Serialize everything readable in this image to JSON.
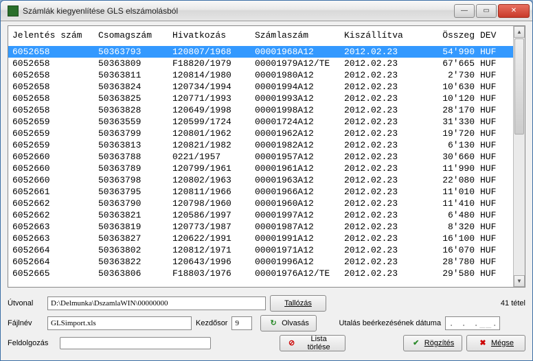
{
  "window": {
    "title": "Számlák kiegyenlítése GLS elszámolásból"
  },
  "columns": {
    "jelentes": "Jelentés szám",
    "csomag": "Csomagszám",
    "hivatkozas": "Hivatkozás",
    "szamla": "Számlaszám",
    "kiszallitva": "Kiszállítva",
    "osszeg": "Összeg",
    "dev": "DEV"
  },
  "rows": [
    {
      "jel": "6052658",
      "cs": "50363793",
      "hiv": "120807/1968",
      "sz": "00001968A12",
      "ki": "2012.02.23",
      "os": "54'990",
      "dev": "HUF",
      "sel": true
    },
    {
      "jel": "6052658",
      "cs": "50363809",
      "hiv": "F18820/1979",
      "sz": "00001979A12/TE",
      "ki": "2012.02.23",
      "os": "67'665",
      "dev": "HUF"
    },
    {
      "jel": "6052658",
      "cs": "50363811",
      "hiv": "120814/1980",
      "sz": "00001980A12",
      "ki": "2012.02.23",
      "os": "2'730",
      "dev": "HUF"
    },
    {
      "jel": "6052658",
      "cs": "50363824",
      "hiv": "120734/1994",
      "sz": "00001994A12",
      "ki": "2012.02.23",
      "os": "10'630",
      "dev": "HUF"
    },
    {
      "jel": "6052658",
      "cs": "50363825",
      "hiv": "120771/1993",
      "sz": "00001993A12",
      "ki": "2012.02.23",
      "os": "10'120",
      "dev": "HUF"
    },
    {
      "jel": "6052658",
      "cs": "50363828",
      "hiv": "120649/1998",
      "sz": "00001998A12",
      "ki": "2012.02.23",
      "os": "28'170",
      "dev": "HUF"
    },
    {
      "jel": "6052659",
      "cs": "50363559",
      "hiv": "120599/1724",
      "sz": "00001724A12",
      "ki": "2012.02.23",
      "os": "31'330",
      "dev": "HUF"
    },
    {
      "jel": "6052659",
      "cs": "50363799",
      "hiv": "120801/1962",
      "sz": "00001962A12",
      "ki": "2012.02.23",
      "os": "19'720",
      "dev": "HUF"
    },
    {
      "jel": "6052659",
      "cs": "50363813",
      "hiv": "120821/1982",
      "sz": "00001982A12",
      "ki": "2012.02.23",
      "os": "6'130",
      "dev": "HUF"
    },
    {
      "jel": "6052660",
      "cs": "50363788",
      "hiv": "0221/1957",
      "sz": "00001957A12",
      "ki": "2012.02.23",
      "os": "30'660",
      "dev": "HUF"
    },
    {
      "jel": "6052660",
      "cs": "50363789",
      "hiv": "120799/1961",
      "sz": "00001961A12",
      "ki": "2012.02.23",
      "os": "11'990",
      "dev": "HUF"
    },
    {
      "jel": "6052660",
      "cs": "50363798",
      "hiv": "120802/1963",
      "sz": "00001963A12",
      "ki": "2012.02.23",
      "os": "22'080",
      "dev": "HUF"
    },
    {
      "jel": "6052661",
      "cs": "50363795",
      "hiv": "120811/1966",
      "sz": "00001966A12",
      "ki": "2012.02.23",
      "os": "11'010",
      "dev": "HUF"
    },
    {
      "jel": "6052662",
      "cs": "50363790",
      "hiv": "120798/1960",
      "sz": "00001960A12",
      "ki": "2012.02.23",
      "os": "11'410",
      "dev": "HUF"
    },
    {
      "jel": "6052662",
      "cs": "50363821",
      "hiv": "120586/1997",
      "sz": "00001997A12",
      "ki": "2012.02.23",
      "os": "6'480",
      "dev": "HUF"
    },
    {
      "jel": "6052663",
      "cs": "50363819",
      "hiv": "120773/1987",
      "sz": "00001987A12",
      "ki": "2012.02.23",
      "os": "8'320",
      "dev": "HUF"
    },
    {
      "jel": "6052663",
      "cs": "50363827",
      "hiv": "120622/1991",
      "sz": "00001991A12",
      "ki": "2012.02.23",
      "os": "16'100",
      "dev": "HUF"
    },
    {
      "jel": "6052664",
      "cs": "50363802",
      "hiv": "120812/1971",
      "sz": "00001971A12",
      "ki": "2012.02.23",
      "os": "16'070",
      "dev": "HUF"
    },
    {
      "jel": "6052664",
      "cs": "50363822",
      "hiv": "120643/1996",
      "sz": "00001996A12",
      "ki": "2012.02.23",
      "os": "28'780",
      "dev": "HUF"
    },
    {
      "jel": "6052665",
      "cs": "50363806",
      "hiv": "F18803/1976",
      "sz": "00001976A12/TE",
      "ki": "2012.02.23",
      "os": "29'580",
      "dev": "HUF"
    }
  ],
  "form": {
    "utvonal_label": "Útvonal",
    "utvonal_value": "D:\\Delmunka\\DszamlaWIN\\00000000",
    "fajlnev_label": "Fájlnév",
    "fajlnev_value": "GLSimport.xls",
    "kezdosor_label": "Kezdősor",
    "kezdosor_value": "9",
    "feldolgozas_label": "Feldolgozás",
    "utalas_label": "Utalás beérkezésének dátuma",
    "date_placeholder": ". . .__.__",
    "count_label": "41 tétel"
  },
  "buttons": {
    "tallozas": "Tallózás",
    "olvasas": "Olvasás",
    "torles": "Lista törlése",
    "rogzites": "Rögzítés",
    "megse": "Mégse"
  }
}
